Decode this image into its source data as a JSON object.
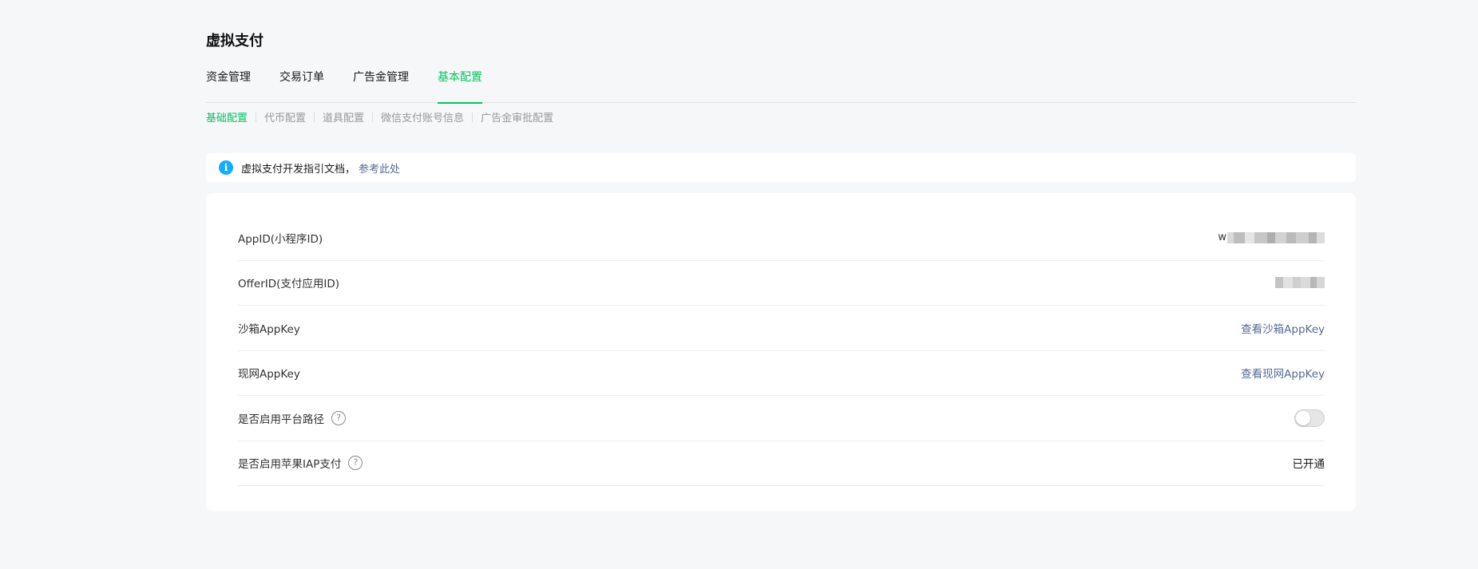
{
  "page": {
    "title": "虚拟支付"
  },
  "tabs": [
    {
      "label": "资金管理",
      "active": false
    },
    {
      "label": "交易订单",
      "active": false
    },
    {
      "label": "广告金管理",
      "active": false
    },
    {
      "label": "基本配置",
      "active": true
    }
  ],
  "subtabs": [
    {
      "label": "基础配置",
      "active": true
    },
    {
      "label": "代币配置",
      "active": false
    },
    {
      "label": "道具配置",
      "active": false
    },
    {
      "label": "微信支付账号信息",
      "active": false
    },
    {
      "label": "广告金审批配置",
      "active": false
    }
  ],
  "notice": {
    "icon": "info-icon",
    "text": "虚拟支付开发指引文档，",
    "link": "参考此处"
  },
  "config": {
    "appid": {
      "label": "AppID(小程序ID)",
      "value_prefix": "w"
    },
    "offerid": {
      "label": "OfferID(支付应用ID)"
    },
    "sandbox_key": {
      "label": "沙箱AppKey",
      "action": "查看沙箱AppKey"
    },
    "live_key": {
      "label": "现网AppKey",
      "action": "查看现网AppKey"
    },
    "platform_path": {
      "label": "是否启用平台路径",
      "enabled": false
    },
    "apple_iap": {
      "label": "是否启用苹果IAP支付",
      "status": "已开通"
    }
  },
  "colors": {
    "accent": "#07c160",
    "link": "#576b95",
    "info": "#10aeff",
    "background": "#f6f7f9"
  }
}
